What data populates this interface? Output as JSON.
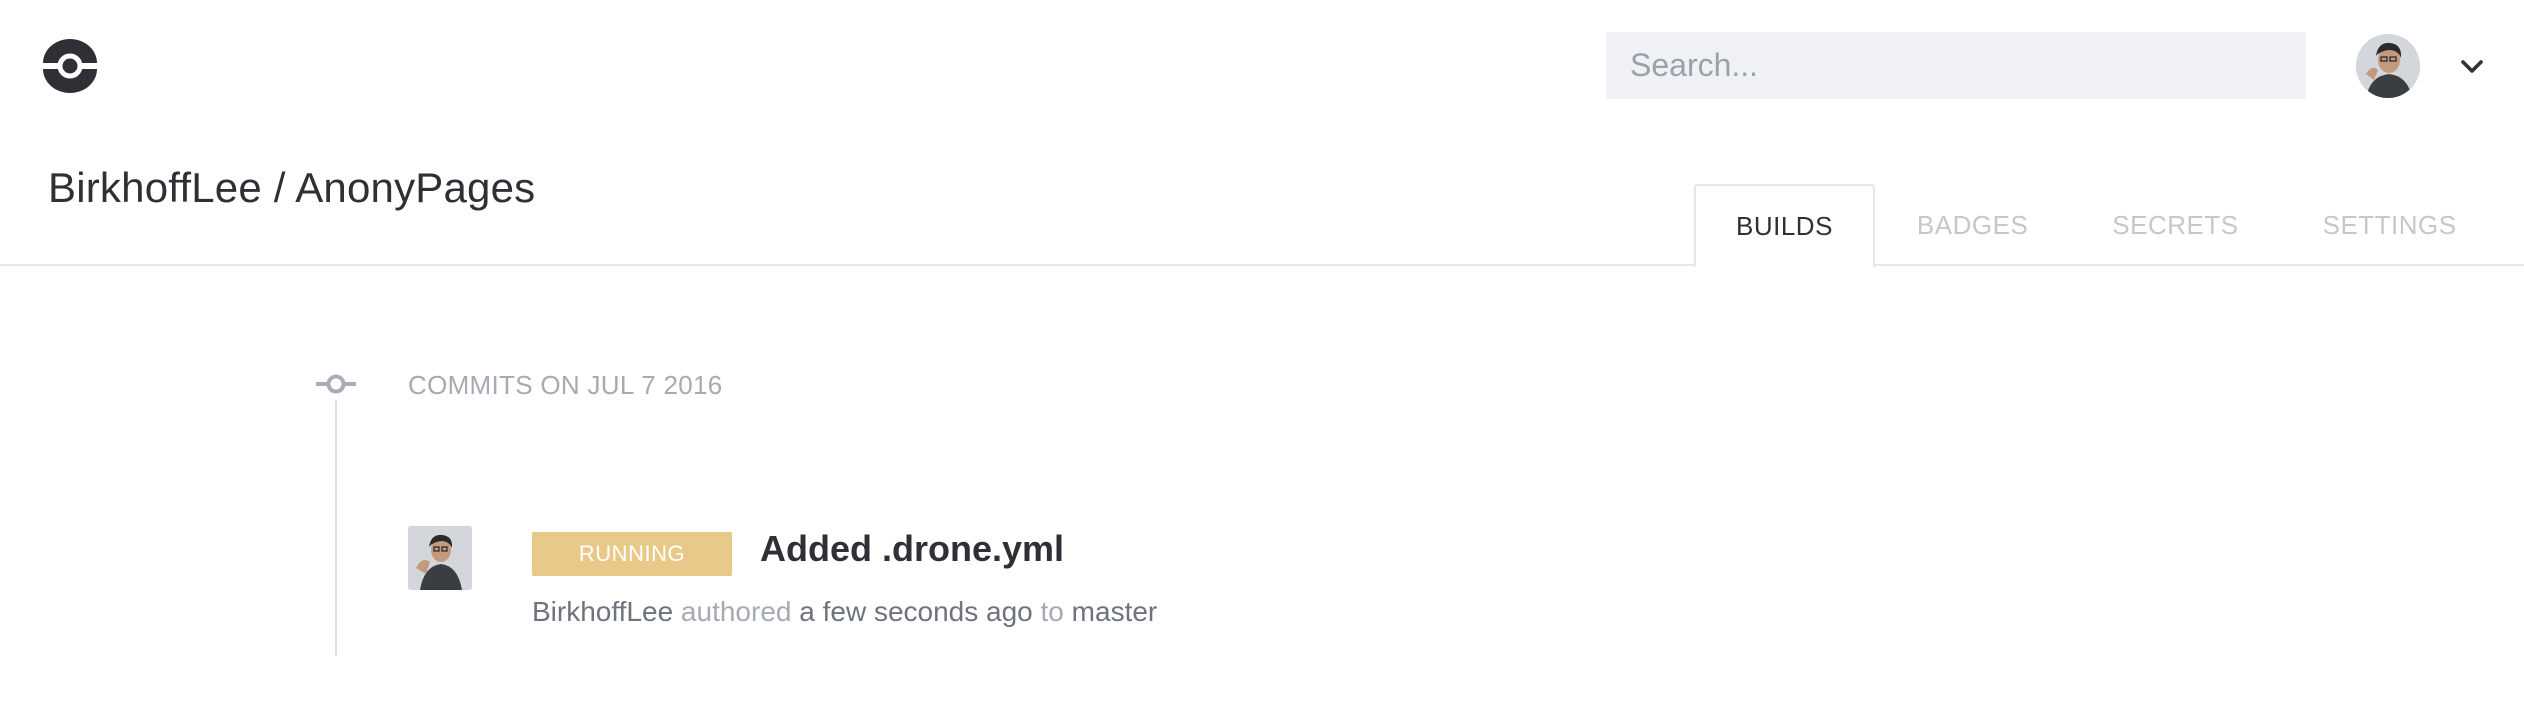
{
  "header": {
    "logo_icon": "drone-logo-icon",
    "search": {
      "placeholder": "Search...",
      "value": ""
    },
    "user_menu": {
      "avatar_icon": "user-avatar",
      "chevron_icon": "chevron-down-icon"
    }
  },
  "repo": {
    "title": "BirkhoffLee / AnonyPages"
  },
  "tabs": [
    {
      "label": "BUILDS",
      "active": true
    },
    {
      "label": "BADGES",
      "active": false
    },
    {
      "label": "SECRETS",
      "active": false
    },
    {
      "label": "SETTINGS",
      "active": false
    }
  ],
  "timeline": {
    "date_heading": "COMMITS ON JUL 7 2016",
    "builds": [
      {
        "status": "RUNNING",
        "status_color": "#e9c987",
        "message": "Added .drone.yml",
        "author": "BirkhoffLee",
        "verb": "authored",
        "time": "a few seconds ago",
        "to_word": "to",
        "branch": "master"
      }
    ]
  },
  "colors": {
    "text": "#2e3036",
    "muted": "#a5aab3",
    "border": "#e5e7eb",
    "search_bg": "#eff1f4"
  }
}
